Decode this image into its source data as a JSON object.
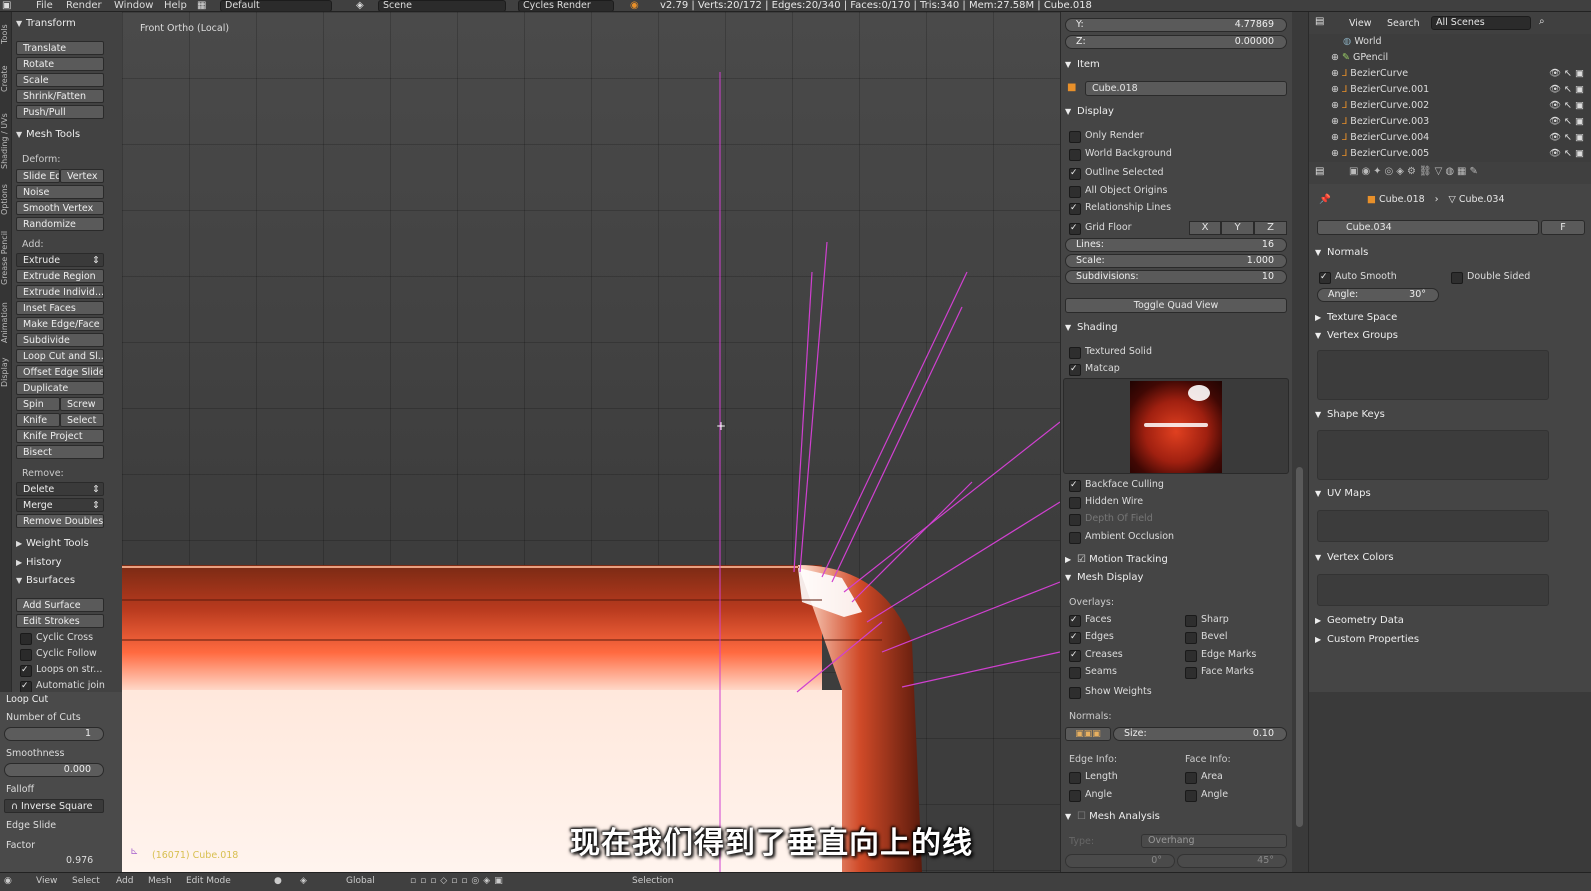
{
  "topbar": {
    "menus": [
      "File",
      "Render",
      "Window",
      "Help"
    ],
    "layout": "Default",
    "scene": "Scene",
    "engine": "Cycles Render",
    "stats": "v2.79 | Verts:20/172 | Edges:20/340 | Faces:0/170 | Tris:340 | Mem:27.58M | Cube.018"
  },
  "left_tabs": [
    "Tools",
    "Create",
    "Shading / UVs",
    "Options",
    "Grease Pencil",
    "Animation",
    "Display"
  ],
  "toolshelf": {
    "transform_header": "Transform",
    "transform_buttons": [
      "Translate",
      "Rotate",
      "Scale",
      "Shrink/Fatten",
      "Push/Pull"
    ],
    "mesh_tools_header": "Mesh Tools",
    "deform_label": "Deform:",
    "slide_edge": "Slide Ed",
    "vertex": "Vertex",
    "noise": "Noise",
    "smooth_vertex": "Smooth Vertex",
    "randomize": "Randomize",
    "add_label": "Add:",
    "extrude": "Extrude",
    "extrude_region": "Extrude Region",
    "extrude_individual": "Extrude Individ...",
    "inset_faces": "Inset Faces",
    "make_edge_face": "Make Edge/Face",
    "subdivide": "Subdivide",
    "loop_cut": "Loop Cut and Sl...",
    "offset_edge_slide": "Offset Edge Slide",
    "duplicate": "Duplicate",
    "spin": "Spin",
    "screw": "Screw",
    "knife": "Knife",
    "select": "Select",
    "knife_project": "Knife Project",
    "bisect": "Bisect",
    "remove_label": "Remove:",
    "delete": "Delete",
    "merge": "Merge",
    "remove_doubles": "Remove Doubles",
    "weight_tools": "Weight Tools",
    "history": "History",
    "bsurfaces": "Bsurfaces",
    "add_surface": "Add Surface",
    "edit_strokes": "Edit Strokes",
    "cyclic_cross": "Cyclic Cross",
    "cyclic_follow": "Cyclic Follow",
    "loops_on_strokes": "Loops on str...",
    "automatic_join": "Automatic join"
  },
  "operator": {
    "title": "Loop Cut",
    "cuts_label": "Number of Cuts",
    "cuts_value": "1",
    "smoothness_label": "Smoothness",
    "smoothness_value": "0.000",
    "falloff_label": "Falloff",
    "falloff_value": "Inverse Square",
    "edge_slide_label": "Edge Slide",
    "factor_label": "Factor",
    "factor_value": "0.976"
  },
  "viewport": {
    "title": "Front Ortho (Local)",
    "info": "(16071) Cube.018",
    "subtitle": "现在我们得到了垂直向上的线"
  },
  "npanel": {
    "y_label": "Y:",
    "y_value": "4.77869",
    "z_label": "Z:",
    "z_value": "0.00000",
    "item_header": "Item",
    "item_name": "Cube.018",
    "display_header": "Display",
    "only_render": "Only Render",
    "world_background": "World Background",
    "outline_selected": "Outline Selected",
    "all_object_origins": "All Object Origins",
    "relationship_lines": "Relationship Lines",
    "grid_floor": "Grid Floor",
    "axis_x": "X",
    "axis_y": "Y",
    "axis_z": "Z",
    "lines_label": "Lines:",
    "lines_value": "16",
    "scale_label": "Scale:",
    "scale_value": "1.000",
    "subdiv_label": "Subdivisions:",
    "subdiv_value": "10",
    "toggle_quad": "Toggle Quad View",
    "shading_header": "Shading",
    "textured_solid": "Textured Solid",
    "matcap": "Matcap",
    "backface_culling": "Backface Culling",
    "hidden_wire": "Hidden Wire",
    "depth_of_field": "Depth Of Field",
    "ambient_occlusion": "Ambient Occlusion",
    "motion_tracking": "Motion Tracking",
    "mesh_display_header": "Mesh Display",
    "overlays_label": "Overlays:",
    "faces": "Faces",
    "sharp": "Sharp",
    "edges": "Edges",
    "bevel": "Bevel",
    "creases": "Creases",
    "edge_marks": "Edge Marks",
    "seams": "Seams",
    "face_marks": "Face Marks",
    "show_weights": "Show Weights",
    "normals_label": "Normals:",
    "size_label": "Size:",
    "size_value": "0.10",
    "edge_info_label": "Edge Info:",
    "face_info_label": "Face Info:",
    "length": "Length",
    "area": "Area",
    "angle": "Angle",
    "face_angle": "Angle",
    "mesh_analysis": "Mesh Analysis",
    "type_label": "Type:",
    "type_value": "Overhang",
    "min_angle": "0°",
    "max_angle": "45°"
  },
  "outliner": {
    "view": "View",
    "search": "Search",
    "scope": "All Scenes",
    "items": [
      "World",
      "GPencil",
      "BezierCurve",
      "BezierCurve.001",
      "BezierCurve.002",
      "BezierCurve.003",
      "BezierCurve.004",
      "BezierCurve.005"
    ]
  },
  "properties": {
    "breadcrumb_object": "Cube.018",
    "breadcrumb_mesh": "Cube.034",
    "mesh_name": "Cube.034",
    "fake_user": "F",
    "normals_header": "Normals",
    "auto_smooth": "Auto Smooth",
    "double_sided": "Double Sided",
    "angle_label": "Angle:",
    "angle_value": "30°",
    "texture_space": "Texture Space",
    "vertex_groups": "Vertex Groups",
    "shape_keys": "Shape Keys",
    "uv_maps": "UV Maps",
    "vertex_colors": "Vertex Colors",
    "geometry_data": "Geometry Data",
    "custom_properties": "Custom Properties"
  },
  "bottombar": {
    "view": "View",
    "select": "Select",
    "add": "Add",
    "mesh": "Mesh",
    "mode": "Edit Mode",
    "orientation": "Global",
    "selection": "Selection"
  },
  "colors": {
    "accent_select": "#5680c2",
    "mesh_red": "#b83a1e",
    "normal_lines": "#d040d0"
  }
}
